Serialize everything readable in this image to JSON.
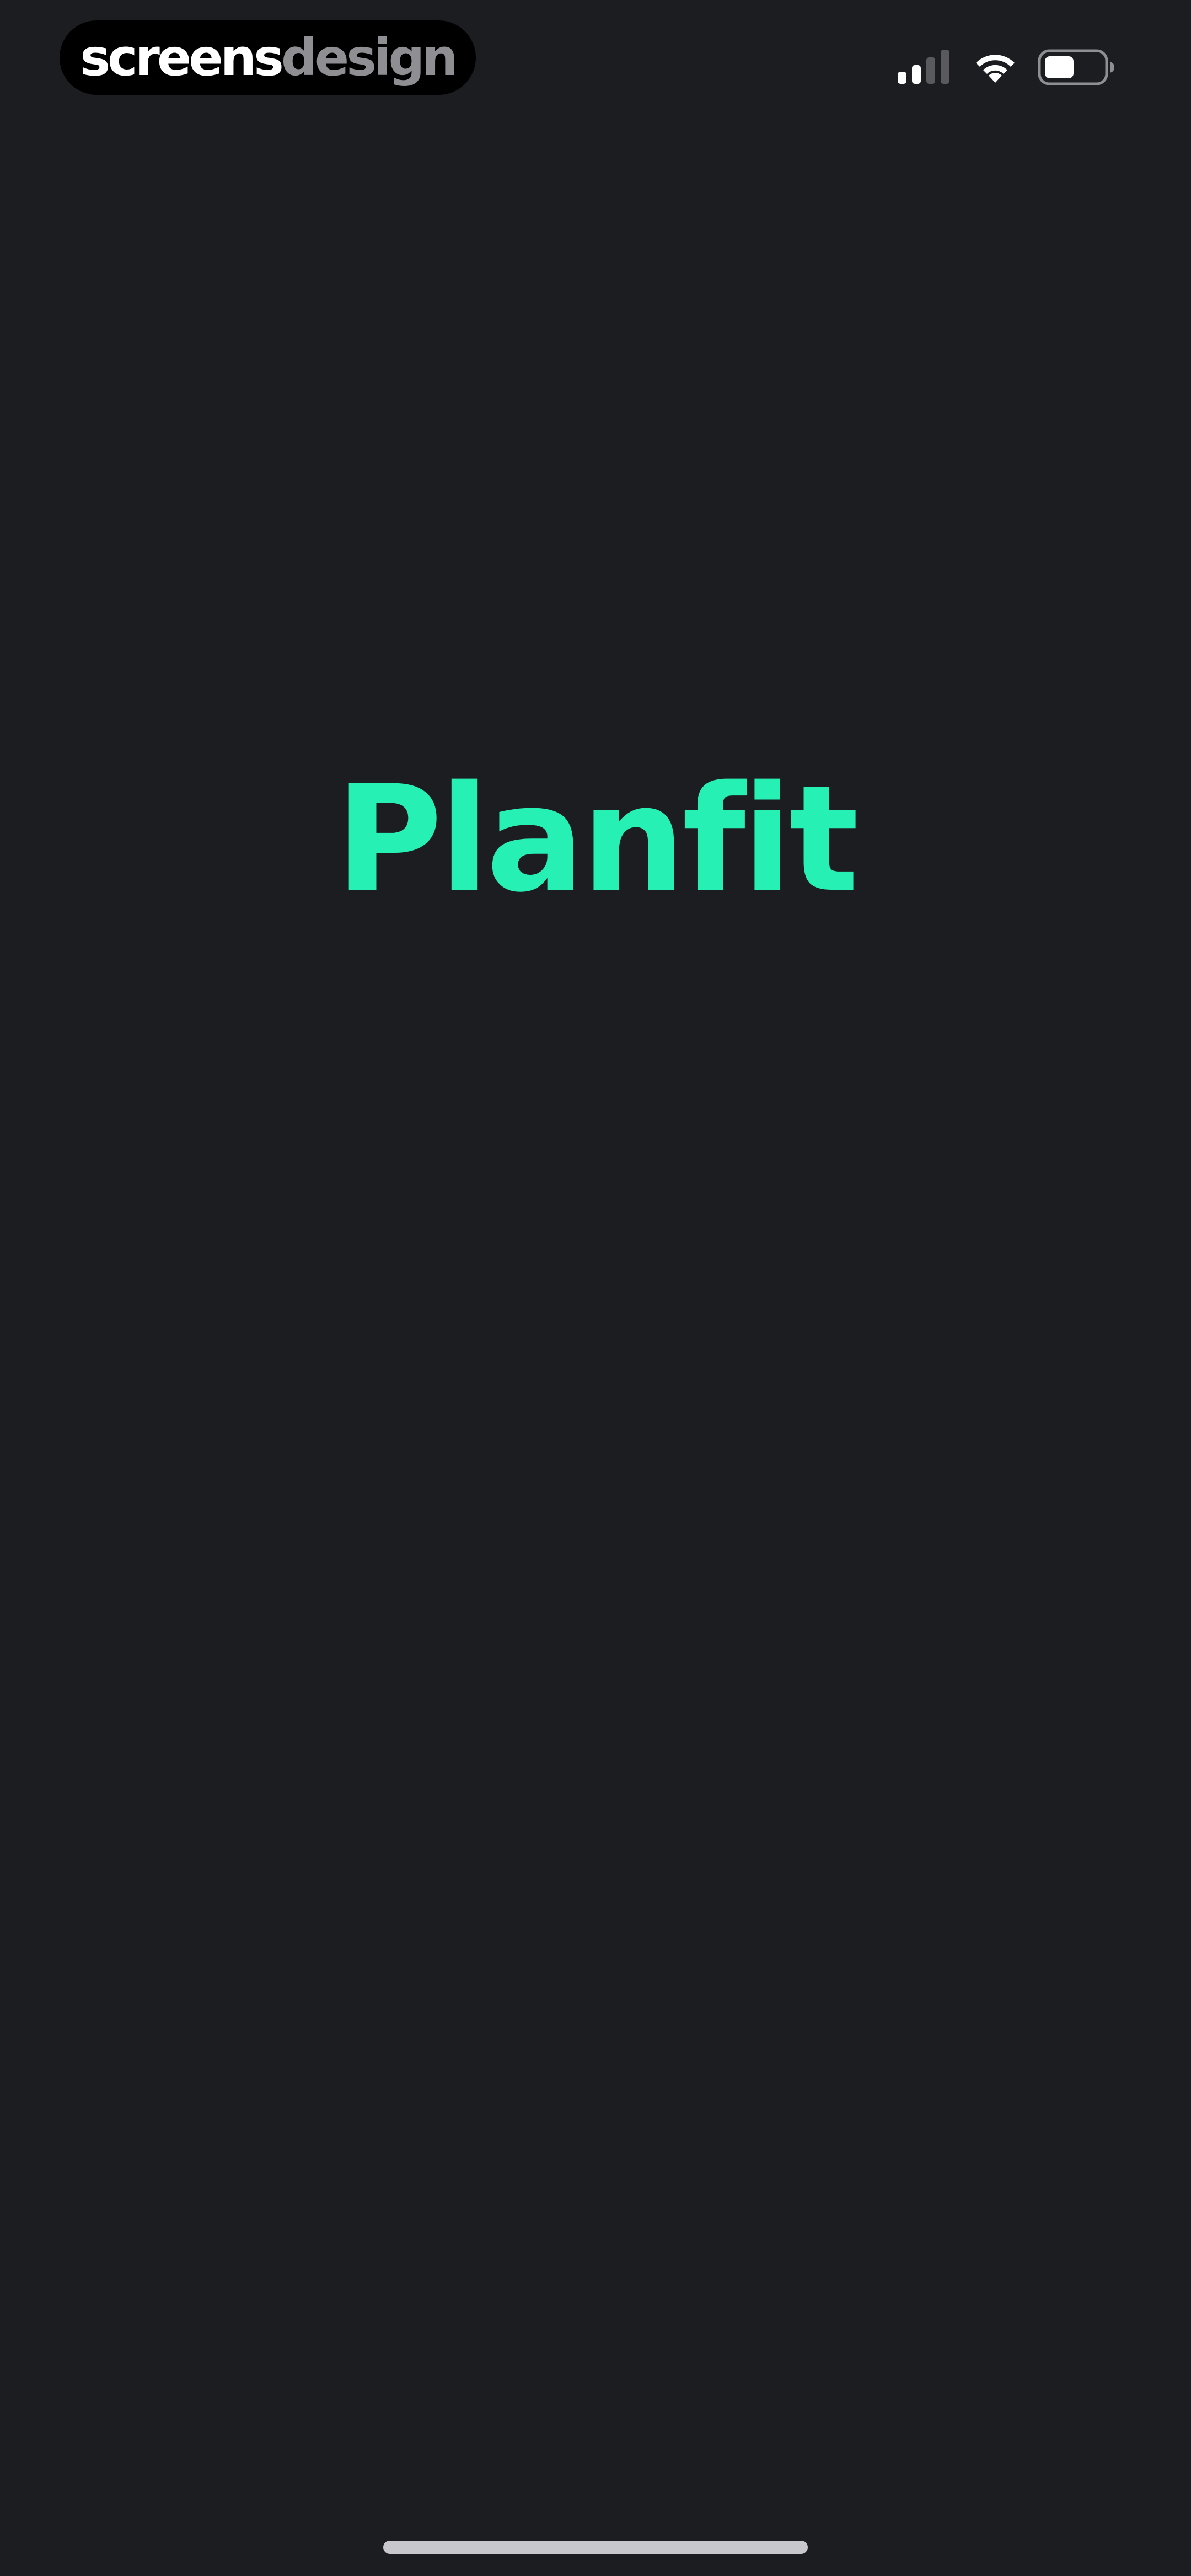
{
  "watermark": {
    "part1": "screens",
    "part2": "design"
  },
  "status_bar": {
    "icons": [
      "cellular-signal-icon",
      "wifi-icon",
      "battery-icon"
    ]
  },
  "splash": {
    "brand": "Planfit",
    "brand_color": "#27F0B5",
    "background_color": "#1C1D20"
  }
}
